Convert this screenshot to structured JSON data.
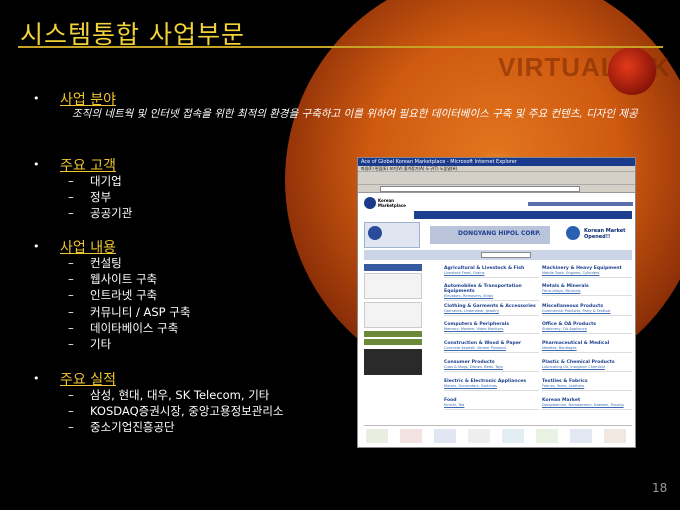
{
  "slide": {
    "title": "시스템통합 사업부문",
    "watermark": "VIRTUALTEK",
    "page_number": "18"
  },
  "sections": [
    {
      "heading": "사업 분야",
      "description": "조직의 네트웍 및 인터넷 접속을 위한 최적의 환경을 구축하고 이를 위하여 필요한 데이터베이스 구축 및 주요 컨텐츠, 디자인 제공"
    },
    {
      "heading": "주요 고객",
      "items": [
        "대기업",
        "정부",
        "공공기관"
      ]
    },
    {
      "heading": "사업 내용",
      "items": [
        "컨설팅",
        "웹사이트 구축",
        "인트라넷 구축",
        "커뮤니티 / ASP 구축",
        "데이타베이스 구축",
        "기타"
      ]
    },
    {
      "heading": "주요 실적",
      "items": [
        "삼성, 현대, 대우, SK Telecom, 기타",
        "KOSDAQ증권시장, 중앙고용정보관리소",
        "중소기업진흥공단"
      ]
    }
  ],
  "bullet_glyph": "•",
  "dash_glyph": "–",
  "screenshot": {
    "window_title": "Ace of Global Korean Marketplace - Microsoft Internet Explorer",
    "menu": "파일(F) 편집(E) 보기(V) 즐겨찾기(A) 도구(T) 도움말(H)",
    "logo_text": "Korean Marketplace",
    "banner_company": "DONGYANG HIPOL CORP.",
    "banner_right": "Korean Market Opened!!",
    "categories": [
      {
        "name": "Agricultural & Livestock & Fish",
        "sub": "Livestock Feed, Grains"
      },
      {
        "name": "Automobiles & Transportation Equipments",
        "sub": "Elevators, Removers, Ships"
      },
      {
        "name": "Clothing & Garments & Accessories",
        "sub": "Garments, Underwear, Jewelry"
      },
      {
        "name": "Computers & Peripherals",
        "sub": "Memory, Modem, Video Monitors"
      },
      {
        "name": "Construction & Wood & Paper",
        "sub": "Concrete Asphalt, Veneer Plywood"
      },
      {
        "name": "Consumer Products",
        "sub": "Cups & Mugs, Dishes, Beds, Toys"
      },
      {
        "name": "Electric & Electronic Appliances",
        "sub": "Motors, Generators, Switches"
      },
      {
        "name": "Food",
        "sub": "Kimchi, Tea"
      },
      {
        "name": "Machinery & Heavy Equipment",
        "sub": "Mobile Tools, Engines, Cylinders"
      },
      {
        "name": "Metals & Minerals",
        "sub": "Ferro-Alloys, Minerals"
      },
      {
        "name": "Miscellaneous Products",
        "sub": "Commercial Products, Party & Festival"
      },
      {
        "name": "Office & OA Products",
        "sub": "Stationery, OA Appliance"
      },
      {
        "name": "Pharmaceutical & Medical",
        "sub": "Needles, Bandages"
      },
      {
        "name": "Plastic & Chemical Products",
        "sub": "Lubricating Oil, Inorganic Chemical"
      },
      {
        "name": "Textiles & Fabrics",
        "sub": "Fabrics, Yarns, Leathers"
      },
      {
        "name": "Korean Market",
        "sub": "Dongdaemun, Namdaemun, Itaewon, Pusung"
      }
    ]
  }
}
